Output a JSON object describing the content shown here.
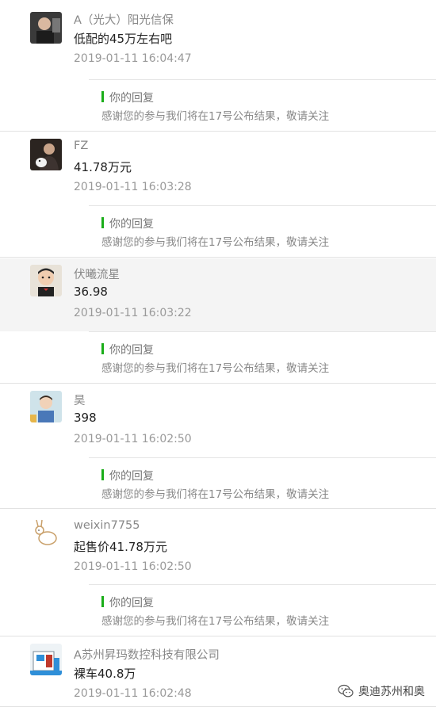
{
  "comments": [
    {
      "avatar_icon": "user-photo-icon",
      "nickname": "A（光大）阳光信保",
      "content": "低配的45万左右吧",
      "time": "2019-01-11 16:04:47",
      "reply": {
        "title": "你的回复",
        "text": "感谢您的参与我们将在17号公布结果，敬请关注"
      }
    },
    {
      "avatar_icon": "user-photo-icon",
      "nickname": "FZ",
      "content": "41.78万元",
      "time": "2019-01-11 16:03:28",
      "reply": {
        "title": "你的回复",
        "text": "感谢您的参与我们将在17号公布结果，敬请关注"
      }
    },
    {
      "avatar_icon": "user-photo-icon",
      "nickname": "伏曦流星",
      "content": "36.98",
      "time": "2019-01-11 16:03:22",
      "reply": {
        "title": "你的回复",
        "text": "感谢您的参与我们将在17号公布结果，敬请关注"
      }
    },
    {
      "avatar_icon": "user-photo-icon",
      "nickname": "昊",
      "content": "398",
      "time": "2019-01-11 16:02:50",
      "reply": {
        "title": "你的回复",
        "text": "感谢您的参与我们将在17号公布结果，敬请关注"
      }
    },
    {
      "avatar_icon": "user-photo-icon",
      "nickname": "weixin7755",
      "content": "起售价41.78万元",
      "time": "2019-01-11 16:02:50",
      "reply": {
        "title": "你的回复",
        "text": "感谢您的参与我们将在17号公布结果，敬请关注"
      }
    },
    {
      "avatar_icon": "user-photo-icon",
      "nickname": "A苏州昇玛数控科技有限公司",
      "content": "裸车40.8万",
      "time": "2019-01-11 16:02:48"
    }
  ],
  "watermark": {
    "icon": "wechat-icon",
    "text": "奥迪苏州和奥"
  },
  "colors": {
    "reply_bar": "#1aad19",
    "highlight_bg": "#f4f4f4"
  }
}
